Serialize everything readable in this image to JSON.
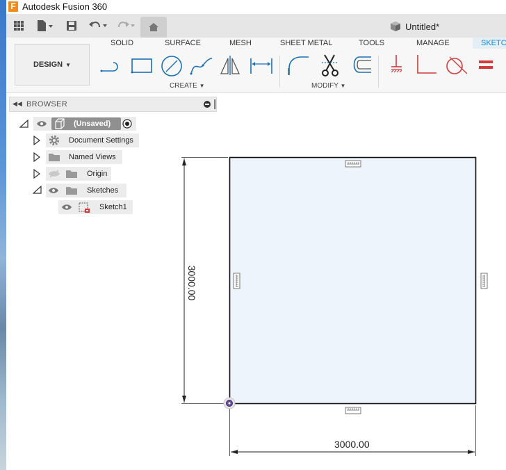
{
  "window": {
    "app_title": "Autodesk Fusion 360",
    "app_logo_letter": "F"
  },
  "quick_access": {
    "document_title": "Untitled*"
  },
  "ribbon": {
    "workspace_label": "DESIGN",
    "tabs": [
      "SOLID",
      "SURFACE",
      "MESH",
      "SHEET METAL",
      "TOOLS",
      "MANAGE",
      "SKETC"
    ],
    "active_tab": "SKETC",
    "groups": {
      "create": "CREATE",
      "modify": "MODIFY"
    },
    "accent_color": "#1a8ad6"
  },
  "browser": {
    "header_label": "BROWSER",
    "root": "(Unsaved)",
    "items": [
      {
        "label": "Document Settings",
        "icon": "gear-icon"
      },
      {
        "label": "Named Views",
        "icon": "folder-icon"
      },
      {
        "label": "Origin",
        "icon": "folder-icon"
      },
      {
        "label": "Sketches",
        "icon": "folder-icon"
      }
    ],
    "sketch": "Sketch1"
  },
  "sketch": {
    "width_dimension": "3000.00",
    "height_dimension": "3000.00",
    "fill_color": "#eef4fb",
    "line_color": "#111111"
  }
}
